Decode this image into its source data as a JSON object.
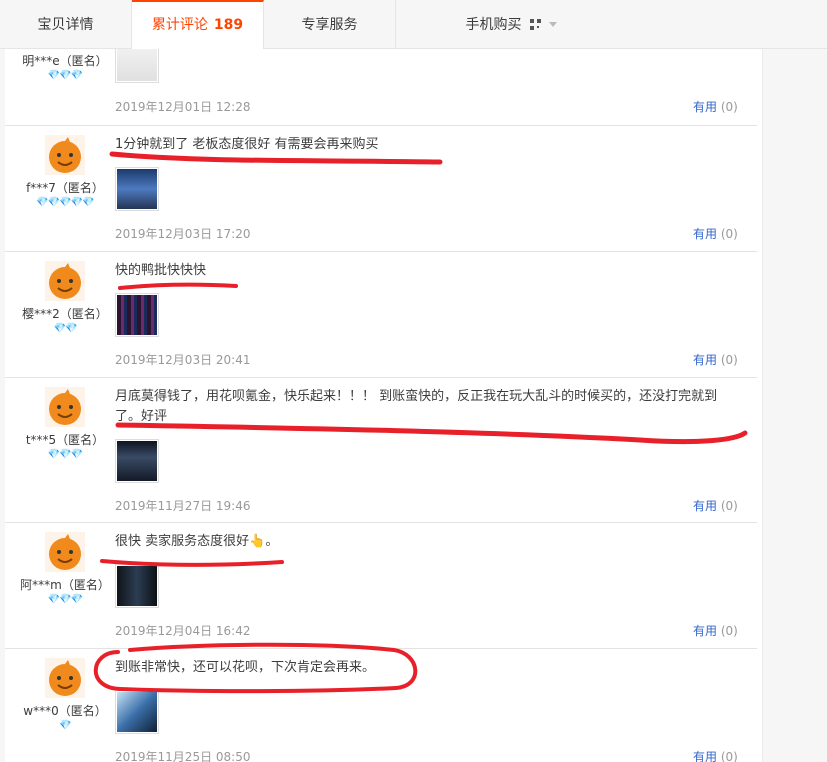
{
  "tabs": {
    "details": "宝贝详情",
    "reviews": "累计评论",
    "review_count": "189",
    "service": "专享服务",
    "mobile": "手机购买"
  },
  "reviews": [
    {
      "user": "明***e（匿名）",
      "stars": "💎💎💎",
      "text": "",
      "date": "2019年12月01日 12:28",
      "useful": "有用",
      "useful_count": "(0)"
    },
    {
      "user": "f***7（匿名）",
      "stars": "💎💎💎💎💎",
      "text": "1分钟就到了 老板态度很好 有需要会再来购买",
      "date": "2019年12月03日 17:20",
      "useful": "有用",
      "useful_count": "(0)"
    },
    {
      "user": "樱***2（匿名）",
      "stars": "💎💎",
      "text": "快的鸭批快快快",
      "date": "2019年12月03日 20:41",
      "useful": "有用",
      "useful_count": "(0)"
    },
    {
      "user": "t***5（匿名）",
      "stars": "💎💎💎",
      "text": "月底莫得钱了，用花呗氪金，快乐起来！！！ 到账蛮快的，反正我在玩大乱斗的时候买的，还没打完就到了。好评",
      "date": "2019年11月27日 19:46",
      "useful": "有用",
      "useful_count": "(0)"
    },
    {
      "user": "阿***m（匿名）",
      "stars": "💎💎💎",
      "text": "很快 卖家服务态度很好👆。",
      "date": "2019年12月04日 16:42",
      "useful": "有用",
      "useful_count": "(0)"
    },
    {
      "user": "w***0（匿名）",
      "stars": "💎",
      "text": "到账非常快，还可以花呗，下次肯定会再来。",
      "date": "2019年11月25日 08:50",
      "useful": "有用",
      "useful_count": "(0)"
    }
  ],
  "colors": {
    "accent": "#ff4400",
    "annotation": "#e8202a",
    "link": "#3366cc"
  }
}
